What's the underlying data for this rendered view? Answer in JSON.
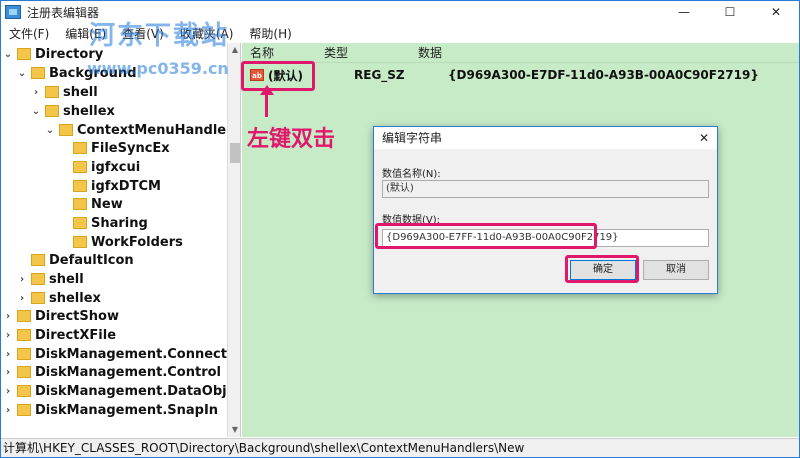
{
  "window": {
    "title": "注册表编辑器",
    "controls": [
      "—",
      "☐",
      "✕"
    ]
  },
  "menu": [
    "文件(F)",
    "编辑(E)",
    "查看(V)",
    "收藏夹(A)",
    "帮助(H)"
  ],
  "watermark": {
    "brand": "河东下载站",
    "url": "www.pc0359.cn"
  },
  "tree": {
    "nodes": [
      {
        "label": "Directory",
        "expander": "⌄"
      },
      {
        "label": "Background",
        "expander": "⌄"
      },
      {
        "label": "shell",
        "expander": "›"
      },
      {
        "label": "shellex",
        "expander": "⌄"
      },
      {
        "label": "ContextMenuHandlers",
        "expander": "⌄"
      },
      {
        "label": "FileSyncEx",
        "expander": ""
      },
      {
        "label": "igfxcui",
        "expander": ""
      },
      {
        "label": "igfxDTCM",
        "expander": ""
      },
      {
        "label": "New",
        "expander": ""
      },
      {
        "label": "Sharing",
        "expander": ""
      },
      {
        "label": "WorkFolders",
        "expander": ""
      },
      {
        "label": "DefaultIcon",
        "expander": ""
      },
      {
        "label": "shell",
        "expander": "›"
      },
      {
        "label": "shellex",
        "expander": "›"
      },
      {
        "label": "DirectShow",
        "expander": "›"
      },
      {
        "label": "DirectXFile",
        "expander": "›"
      },
      {
        "label": "DiskManagement.Connection",
        "expander": "›"
      },
      {
        "label": "DiskManagement.Control",
        "expander": "›"
      },
      {
        "label": "DiskManagement.DataObject",
        "expander": "›"
      },
      {
        "label": "DiskManagement.SnapIn",
        "expander": "›"
      }
    ]
  },
  "list": {
    "headers": {
      "name": "名称",
      "type": "类型",
      "data": "数据"
    },
    "rows": [
      {
        "icon": "ab",
        "name": "(默认)",
        "type": "REG_SZ",
        "data": "{D969A300-E7DF-11d0-A93B-00A0C90F2719}"
      }
    ]
  },
  "callout": {
    "text": "左键双击"
  },
  "dialog": {
    "title": "编辑字符串",
    "close": "✕",
    "name_label": "数值名称(N):",
    "name_value": "(默认)",
    "data_label": "数值数据(V):",
    "data_value": "{D969A300-E7FF-11d0-A93B-00A0C90F2719}",
    "ok_label": "确定",
    "cancel_label": "取消"
  },
  "statusbar": {
    "path": "计算机\\HKEY_CLASSES_ROOT\\Directory\\Background\\shellex\\ContextMenuHandlers\\New"
  },
  "colors": {
    "accent": "#e0186c",
    "list_background": "#c7ebc7",
    "folder": "#f3c64a"
  }
}
